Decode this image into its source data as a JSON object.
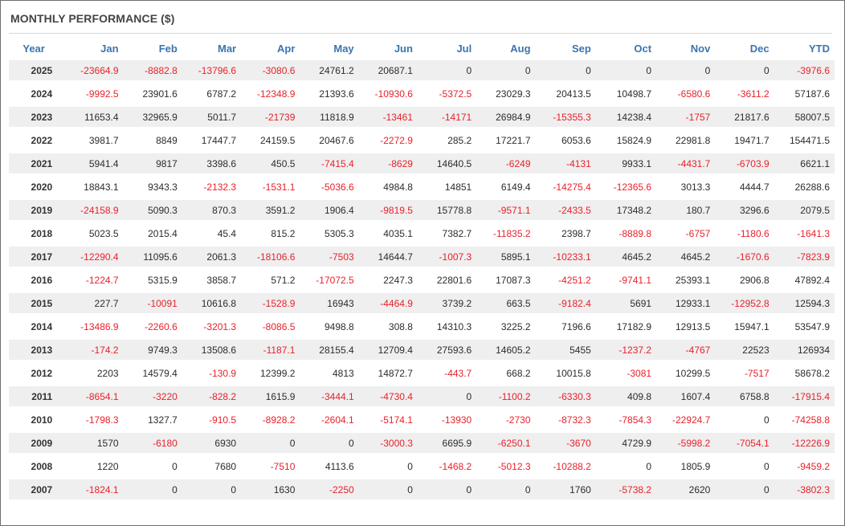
{
  "title": "MONTHLY PERFORMANCE ($)",
  "colors": {
    "header": "#3a74b0",
    "negative": "#e8212b",
    "row_alt": "#efefef"
  },
  "table": {
    "headers": [
      "Year",
      "Jan",
      "Feb",
      "Mar",
      "Apr",
      "May",
      "Jun",
      "Jul",
      "Aug",
      "Sep",
      "Oct",
      "Nov",
      "Dec",
      "YTD"
    ],
    "rows": [
      [
        "2025",
        "-23664.9",
        "-8882.8",
        "-13796.6",
        "-3080.6",
        "24761.2",
        "20687.1",
        "0",
        "0",
        "0",
        "0",
        "0",
        "0",
        "-3976.6"
      ],
      [
        "2024",
        "-9992.5",
        "23901.6",
        "6787.2",
        "-12348.9",
        "21393.6",
        "-10930.6",
        "-5372.5",
        "23029.3",
        "20413.5",
        "10498.7",
        "-6580.6",
        "-3611.2",
        "57187.6"
      ],
      [
        "2023",
        "11653.4",
        "32965.9",
        "5011.7",
        "-21739",
        "11818.9",
        "-13461",
        "-14171",
        "26984.9",
        "-15355.3",
        "14238.4",
        "-1757",
        "21817.6",
        "58007.5"
      ],
      [
        "2022",
        "3981.7",
        "8849",
        "17447.7",
        "24159.5",
        "20467.6",
        "-2272.9",
        "285.2",
        "17221.7",
        "6053.6",
        "15824.9",
        "22981.8",
        "19471.7",
        "154471.5"
      ],
      [
        "2021",
        "5941.4",
        "9817",
        "3398.6",
        "450.5",
        "-7415.4",
        "-8629",
        "14640.5",
        "-6249",
        "-4131",
        "9933.1",
        "-4431.7",
        "-6703.9",
        "6621.1"
      ],
      [
        "2020",
        "18843.1",
        "9343.3",
        "-2132.3",
        "-1531.1",
        "-5036.6",
        "4984.8",
        "14851",
        "6149.4",
        "-14275.4",
        "-12365.6",
        "3013.3",
        "4444.7",
        "26288.6"
      ],
      [
        "2019",
        "-24158.9",
        "5090.3",
        "870.3",
        "3591.2",
        "1906.4",
        "-9819.5",
        "15778.8",
        "-9571.1",
        "-2433.5",
        "17348.2",
        "180.7",
        "3296.6",
        "2079.5"
      ],
      [
        "2018",
        "5023.5",
        "2015.4",
        "45.4",
        "815.2",
        "5305.3",
        "4035.1",
        "7382.7",
        "-11835.2",
        "2398.7",
        "-8889.8",
        "-6757",
        "-1180.6",
        "-1641.3"
      ],
      [
        "2017",
        "-12290.4",
        "11095.6",
        "2061.3",
        "-18106.6",
        "-7503",
        "14644.7",
        "-1007.3",
        "5895.1",
        "-10233.1",
        "4645.2",
        "4645.2",
        "-1670.6",
        "-7823.9"
      ],
      [
        "2016",
        "-1224.7",
        "5315.9",
        "3858.7",
        "571.2",
        "-17072.5",
        "2247.3",
        "22801.6",
        "17087.3",
        "-4251.2",
        "-9741.1",
        "25393.1",
        "2906.8",
        "47892.4"
      ],
      [
        "2015",
        "227.7",
        "-10091",
        "10616.8",
        "-1528.9",
        "16943",
        "-4464.9",
        "3739.2",
        "663.5",
        "-9182.4",
        "5691",
        "12933.1",
        "-12952.8",
        "12594.3"
      ],
      [
        "2014",
        "-13486.9",
        "-2260.6",
        "-3201.3",
        "-8086.5",
        "9498.8",
        "308.8",
        "14310.3",
        "3225.2",
        "7196.6",
        "17182.9",
        "12913.5",
        "15947.1",
        "53547.9"
      ],
      [
        "2013",
        "-174.2",
        "9749.3",
        "13508.6",
        "-1187.1",
        "28155.4",
        "12709.4",
        "27593.6",
        "14605.2",
        "5455",
        "-1237.2",
        "-4767",
        "22523",
        "126934"
      ],
      [
        "2012",
        "2203",
        "14579.4",
        "-130.9",
        "12399.2",
        "4813",
        "14872.7",
        "-443.7",
        "668.2",
        "10015.8",
        "-3081",
        "10299.5",
        "-7517",
        "58678.2"
      ],
      [
        "2011",
        "-8654.1",
        "-3220",
        "-828.2",
        "1615.9",
        "-3444.1",
        "-4730.4",
        "0",
        "-1100.2",
        "-6330.3",
        "409.8",
        "1607.4",
        "6758.8",
        "-17915.4"
      ],
      [
        "2010",
        "-1798.3",
        "1327.7",
        "-910.5",
        "-8928.2",
        "-2604.1",
        "-5174.1",
        "-13930",
        "-2730",
        "-8732.3",
        "-7854.3",
        "-22924.7",
        "0",
        "-74258.8"
      ],
      [
        "2009",
        "1570",
        "-6180",
        "6930",
        "0",
        "0",
        "-3000.3",
        "6695.9",
        "-6250.1",
        "-3670",
        "4729.9",
        "-5998.2",
        "-7054.1",
        "-12226.9"
      ],
      [
        "2008",
        "1220",
        "0",
        "7680",
        "-7510",
        "4113.6",
        "0",
        "-1468.2",
        "-5012.3",
        "-10288.2",
        "0",
        "1805.9",
        "0",
        "-9459.2"
      ],
      [
        "2007",
        "-1824.1",
        "0",
        "0",
        "1630",
        "-2250",
        "0",
        "0",
        "0",
        "1760",
        "-5738.2",
        "2620",
        "0",
        "-3802.3"
      ]
    ]
  }
}
